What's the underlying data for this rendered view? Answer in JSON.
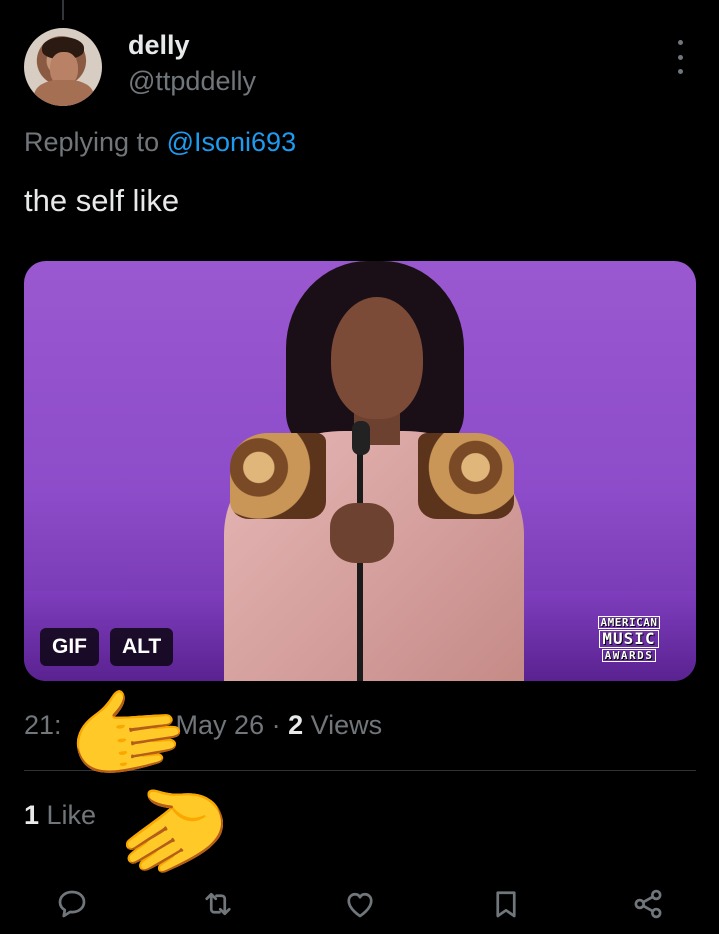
{
  "author": {
    "display_name": "delly",
    "handle": "@ttpddelly"
  },
  "reply": {
    "prefix": "Replying to ",
    "mention": "@Isoni693"
  },
  "tweet": {
    "text": "the self like"
  },
  "media": {
    "gif_badge": "GIF",
    "alt_badge": "ALT",
    "watermark": [
      "AMERICAN",
      "MUSIC",
      "AWARDS"
    ]
  },
  "meta": {
    "time_visible": "21:",
    "date": "May 26",
    "separator": " · ",
    "views_count": "2",
    "views_label": " Views"
  },
  "engagement": {
    "likes_count": "1",
    "likes_label": " Like"
  },
  "overlay_emoji": [
    "🫱",
    "🫲"
  ],
  "actions": [
    "reply-icon",
    "retweet-icon",
    "like-icon",
    "bookmark-icon",
    "share-icon"
  ],
  "colors": {
    "background": "#000000",
    "text": "#e7e9ea",
    "secondary": "#71767b",
    "link": "#1d9bf0",
    "media_purple": "#8d4cc9"
  }
}
